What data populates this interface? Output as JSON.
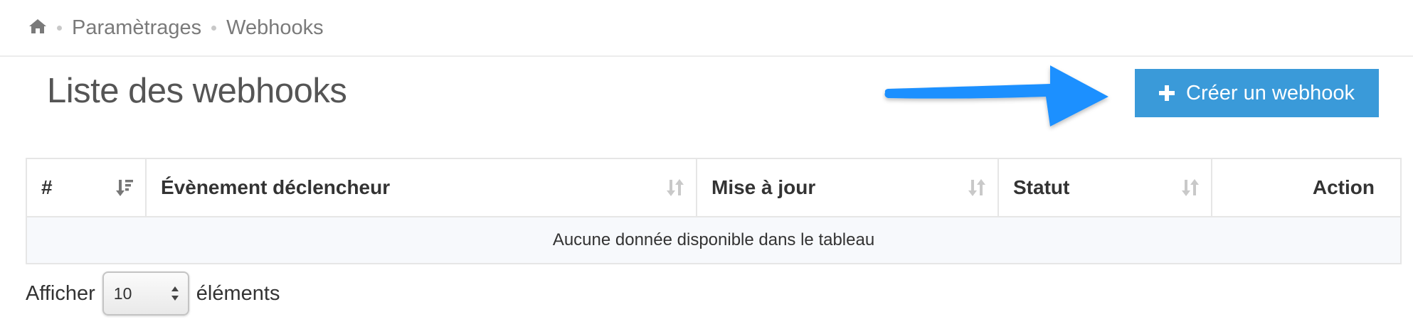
{
  "breadcrumb": {
    "home_icon": "home-icon",
    "items": [
      "Paramètrages",
      "Webhooks"
    ]
  },
  "page": {
    "title": "Liste des webhooks"
  },
  "actions": {
    "create_label": "Créer un webhook",
    "create_icon": "plus-icon",
    "accent_color": "#3a9ad9",
    "annotation_arrow_color": "#1e90ff"
  },
  "table": {
    "columns": [
      {
        "label": "#",
        "sort_icon": "sort-desc-icon"
      },
      {
        "label": "Évènement déclencheur",
        "sort_icon": "sort-icon"
      },
      {
        "label": "Mise à jour",
        "sort_icon": "sort-icon"
      },
      {
        "label": "Statut",
        "sort_icon": "sort-icon"
      },
      {
        "label": "Action",
        "sort_icon": ""
      }
    ],
    "empty_message": "Aucune donnée disponible dans le tableau"
  },
  "length_menu": {
    "prefix": "Afficher",
    "selected": "10",
    "suffix": "éléments"
  }
}
